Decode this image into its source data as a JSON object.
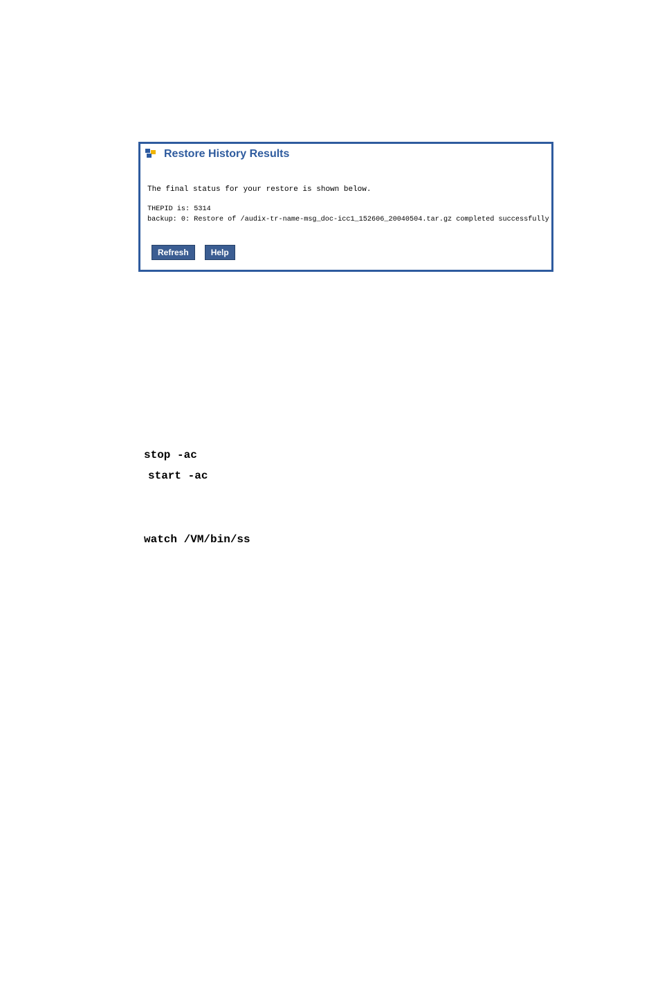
{
  "panel": {
    "title": "Restore History Results",
    "description": "The final status for your restore is shown below.",
    "log_line1": "THEPID is: 5314",
    "log_line2": "backup: 0: Restore of /audix-tr-name-msg_doc-icc1_152606_20040504.tar.gz completed successfully",
    "buttons": {
      "refresh": "Refresh",
      "help": "Help"
    }
  },
  "commands": {
    "cmd1": "stop -ac",
    "cmd2": "start -ac",
    "cmd3": "watch /VM/bin/ss"
  },
  "icons": {
    "flag": "flag-icon"
  }
}
